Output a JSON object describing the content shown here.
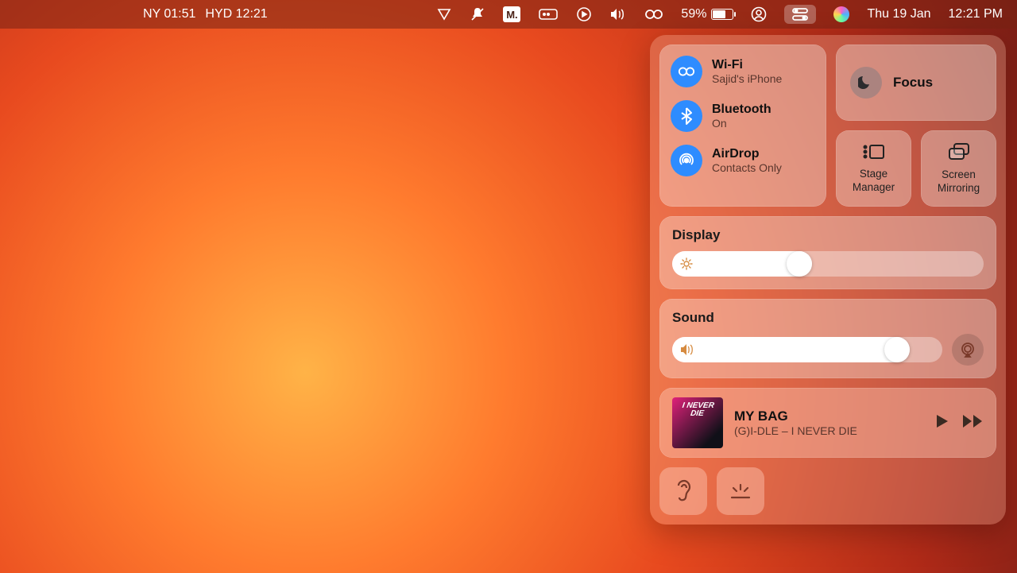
{
  "menubar": {
    "clock_ny": "NY 01:51",
    "clock_hyd": "HYD 12:21",
    "battery_percent": "59%",
    "date": "Thu 19 Jan",
    "time": "12:21 PM"
  },
  "cc": {
    "wifi": {
      "title": "Wi-Fi",
      "sub": "Sajid's iPhone"
    },
    "bluetooth": {
      "title": "Bluetooth",
      "sub": "On"
    },
    "airdrop": {
      "title": "AirDrop",
      "sub": "Contacts Only"
    },
    "focus": {
      "title": "Focus"
    },
    "stage": {
      "label": "Stage\nManager"
    },
    "mirror": {
      "label": "Screen\nMirroring"
    },
    "display": {
      "head": "Display",
      "value_pct": 45
    },
    "sound": {
      "head": "Sound",
      "value_pct": 88
    },
    "music": {
      "title": "MY BAG",
      "sub": "(G)I-DLE – I NEVER DIE",
      "album_text": "I NEVER\nDIE"
    }
  }
}
